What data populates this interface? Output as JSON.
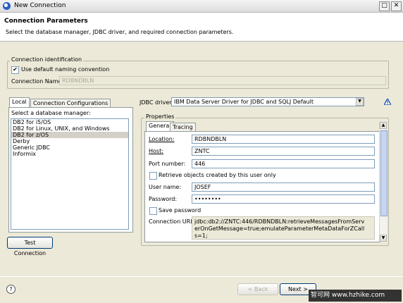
{
  "window": {
    "title": "New Connection",
    "btn_restore": "□",
    "btn_close": "✕"
  },
  "header": {
    "title": "Connection Parameters",
    "subtitle": "Select the database manager, JDBC driver, and required connection parameters."
  },
  "connection_identification": {
    "legend": "Connection identification",
    "use_default_label": "Use default naming convention",
    "use_default_checked": "✔",
    "name_label": "Connection Name:",
    "name_value": "RDBNDBLN"
  },
  "left_tabs": [
    "Local",
    "Connection Configurations"
  ],
  "db_manager": {
    "label": "Select a database manager:",
    "items": [
      "DB2 for i5/OS",
      "DB2 for Linux, UNIX, and Windows",
      "DB2 for z/OS",
      "Derby",
      "Generic JDBC",
      "Informix"
    ],
    "selected": "DB2 for z/OS"
  },
  "test_connection_label": "Test Connection",
  "jdbc": {
    "label": "JDBC driver:",
    "value": "IBM Data Server Driver for JDBC and SQLJ Default",
    "arrow": "▼"
  },
  "properties": {
    "legend": "Properties",
    "tabs": [
      "General",
      "Tracing"
    ],
    "location_label": "Location:",
    "location_value": "RDBNDBLN",
    "host_label": "Host:",
    "host_value": "ZNTC",
    "port_label": "Port number:",
    "port_value": "446",
    "retrieve_label": "Retrieve objects created by this user only",
    "username_label": "User name:",
    "username_value": "JOSEF",
    "password_label": "Password:",
    "password_value": "••••••••",
    "save_password_label": "Save password",
    "url_label": "Connection URL:",
    "url_value": "jdbc:db2://ZNTC:446/RDBNDBLN:retrieveMessagesFromServerOnGetMessage=true;emulateParameterMetaDataForZCalls=1;"
  },
  "footer": {
    "help": "?",
    "back": "< Back",
    "next": "Next >",
    "watermark": "智可网 www.hzhike.com"
  },
  "icons": {
    "title_icon": "eclipse-icon",
    "help_icon": "help-icon",
    "warning_icon": "warning-icon"
  }
}
